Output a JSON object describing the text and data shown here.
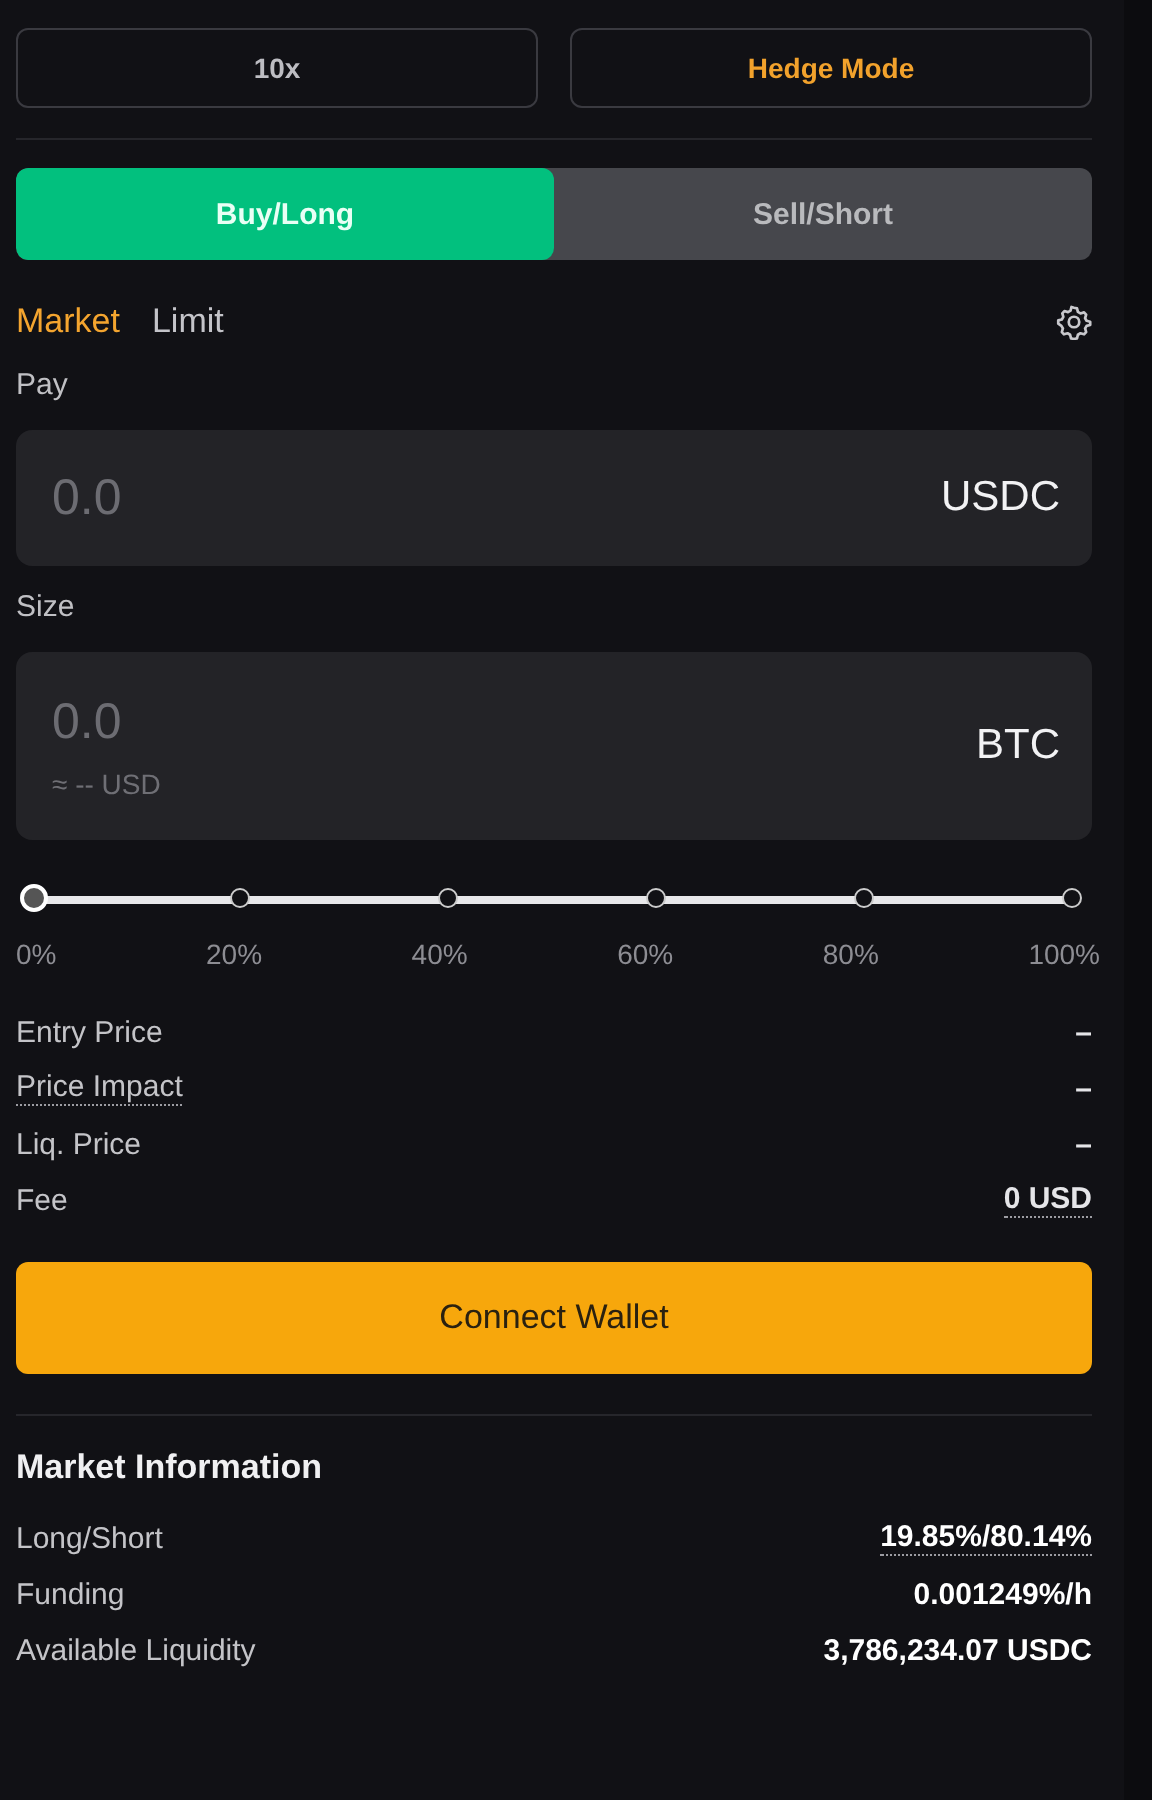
{
  "header_buttons": [
    {
      "label": "10x",
      "kind": "leverage"
    },
    {
      "label": "Hedge Mode",
      "kind": "mode"
    }
  ],
  "side_tabs": [
    {
      "label": "Buy/Long",
      "selected": true
    },
    {
      "label": "Sell/Short",
      "selected": false
    }
  ],
  "order_types": [
    {
      "label": "Market",
      "selected": true
    },
    {
      "label": "Limit",
      "selected": false
    }
  ],
  "pay": {
    "label": "Pay",
    "placeholder": "0.0",
    "currency": "USDC"
  },
  "size": {
    "label": "Size",
    "placeholder": "0.0",
    "usd_estimate": "≈ -- USD",
    "currency": "BTC"
  },
  "slider": {
    "level": 0,
    "ticks": [
      "0%",
      "20%",
      "40%",
      "60%",
      "80%",
      "100%"
    ]
  },
  "details": [
    {
      "label": "Entry Price",
      "value": "–",
      "label_dotted": false,
      "value_dotted": false
    },
    {
      "label": "Price Impact",
      "value": "–",
      "label_dotted": true,
      "value_dotted": false
    },
    {
      "label": "Liq. Price",
      "value": "–",
      "label_dotted": false,
      "value_dotted": false
    },
    {
      "label": "Fee",
      "value": "0 USD",
      "label_dotted": false,
      "value_dotted": true
    }
  ],
  "connect_button": "Connect Wallet",
  "market_info": {
    "title": "Market Information",
    "rows": [
      {
        "label": "Long/Short",
        "value": "19.85%/80.14%",
        "label_dotted": false,
        "value_dotted": true
      },
      {
        "label": "Funding",
        "value": "0.001249%/h",
        "label_dotted": false,
        "value_dotted": false
      },
      {
        "label": "Available Liquidity",
        "value": "3,786,234.07 USDC",
        "label_dotted": false,
        "value_dotted": false
      }
    ]
  }
}
